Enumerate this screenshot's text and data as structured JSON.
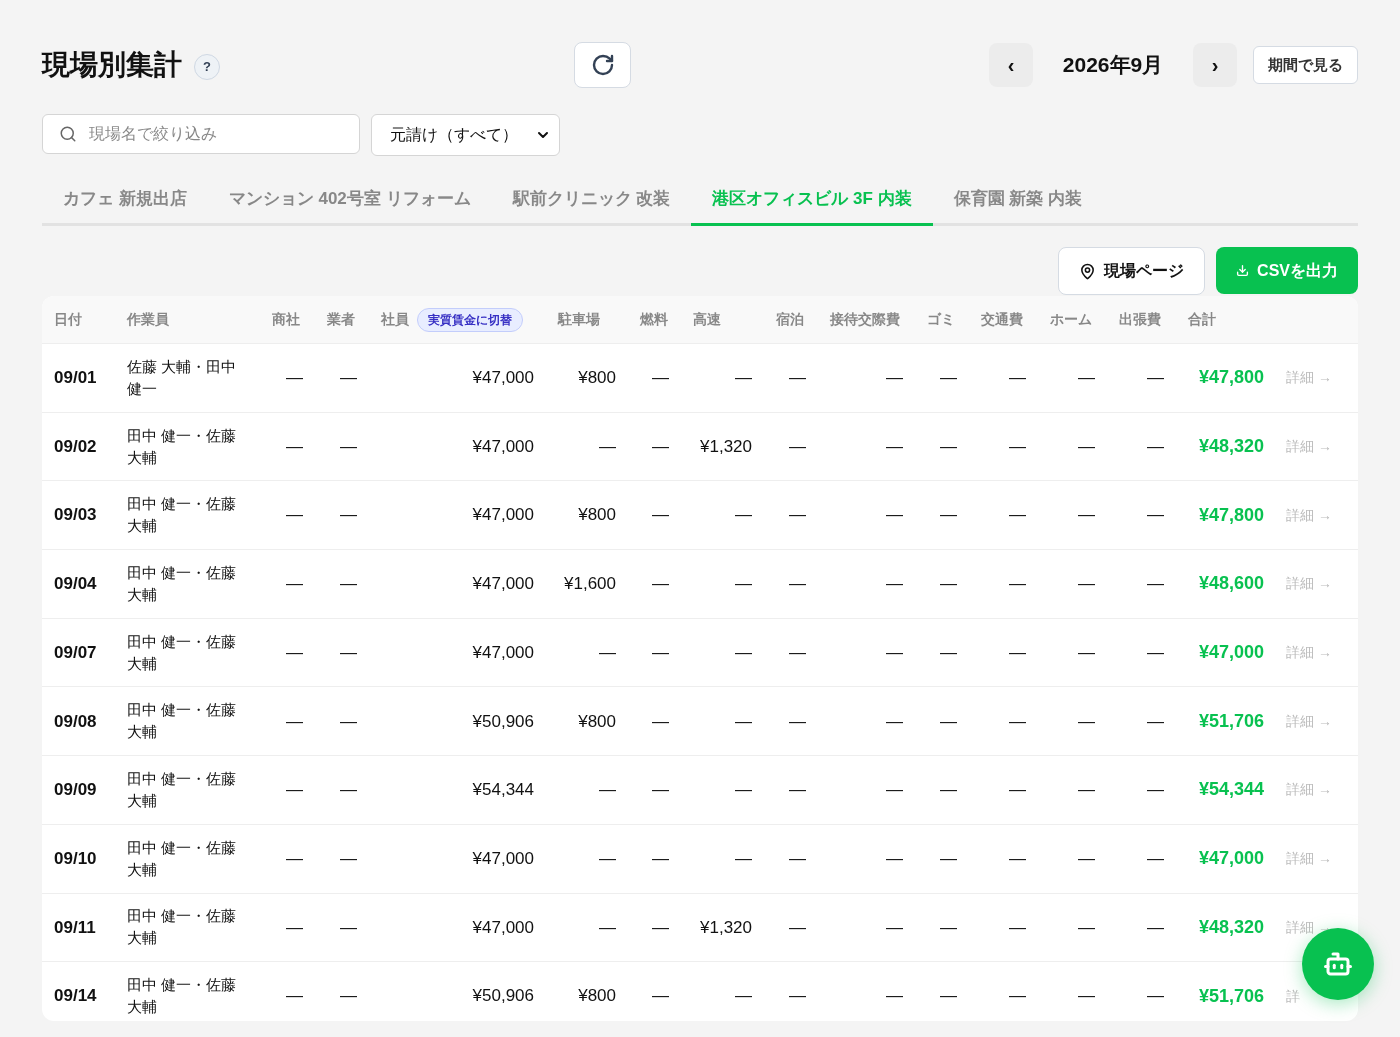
{
  "header": {
    "title": "現場別集計",
    "help": "?",
    "month": "2026年9月",
    "prev": "‹",
    "next": "›",
    "period_button": "期間で見る"
  },
  "filters": {
    "search_placeholder": "現場名で絞り込み",
    "contractor_select": "元請け（すべて）"
  },
  "tabs": [
    {
      "label": "カフェ 新規出店",
      "selected": false
    },
    {
      "label": "マンション 402号室 リフォーム",
      "selected": false
    },
    {
      "label": "駅前クリニック 改装",
      "selected": false
    },
    {
      "label": "港区オフィスビル 3F 内装",
      "selected": true
    },
    {
      "label": "保育園 新築 内装",
      "selected": false
    }
  ],
  "actions": {
    "site_page": "現場ページ",
    "csv_export": "CSVを出力"
  },
  "table": {
    "columns": [
      "日付",
      "作業員",
      "商社",
      "業者",
      "社員",
      "駐車場",
      "燃料",
      "高速",
      "宿泊",
      "接待交際費",
      "ゴミ",
      "交通費",
      "ホーム",
      "出張費",
      "合計"
    ],
    "employee_toggle": "実質賃金に切替",
    "rows": [
      {
        "date": "09/01",
        "workers": "佐藤 大輔・田中健一",
        "values": [
          "—",
          "—",
          "¥47,000",
          "¥800",
          "—",
          "—",
          "—",
          "—",
          "—",
          "—",
          "—",
          "—"
        ],
        "total": "¥47,800",
        "detail": "詳細 →"
      },
      {
        "date": "09/02",
        "workers": "田中 健一・佐藤大輔",
        "values": [
          "—",
          "—",
          "¥47,000",
          "—",
          "—",
          "¥1,320",
          "—",
          "—",
          "—",
          "—",
          "—",
          "—"
        ],
        "total": "¥48,320",
        "detail": "詳細 →"
      },
      {
        "date": "09/03",
        "workers": "田中 健一・佐藤大輔",
        "values": [
          "—",
          "—",
          "¥47,000",
          "¥800",
          "—",
          "—",
          "—",
          "—",
          "—",
          "—",
          "—",
          "—"
        ],
        "total": "¥47,800",
        "detail": "詳細 →"
      },
      {
        "date": "09/04",
        "workers": "田中 健一・佐藤大輔",
        "values": [
          "—",
          "—",
          "¥47,000",
          "¥1,600",
          "—",
          "—",
          "—",
          "—",
          "—",
          "—",
          "—",
          "—"
        ],
        "total": "¥48,600",
        "detail": "詳細 →"
      },
      {
        "date": "09/07",
        "workers": "田中 健一・佐藤大輔",
        "values": [
          "—",
          "—",
          "¥47,000",
          "—",
          "—",
          "—",
          "—",
          "—",
          "—",
          "—",
          "—",
          "—"
        ],
        "total": "¥47,000",
        "detail": "詳細 →"
      },
      {
        "date": "09/08",
        "workers": "田中 健一・佐藤大輔",
        "values": [
          "—",
          "—",
          "¥50,906",
          "¥800",
          "—",
          "—",
          "—",
          "—",
          "—",
          "—",
          "—",
          "—"
        ],
        "total": "¥51,706",
        "detail": "詳細 →"
      },
      {
        "date": "09/09",
        "workers": "田中 健一・佐藤大輔",
        "values": [
          "—",
          "—",
          "¥54,344",
          "—",
          "—",
          "—",
          "—",
          "—",
          "—",
          "—",
          "—",
          "—"
        ],
        "total": "¥54,344",
        "detail": "詳細 →"
      },
      {
        "date": "09/10",
        "workers": "田中 健一・佐藤大輔",
        "values": [
          "—",
          "—",
          "¥47,000",
          "—",
          "—",
          "—",
          "—",
          "—",
          "—",
          "—",
          "—",
          "—"
        ],
        "total": "¥47,000",
        "detail": "詳細 →"
      },
      {
        "date": "09/11",
        "workers": "田中 健一・佐藤大輔",
        "values": [
          "—",
          "—",
          "¥47,000",
          "—",
          "—",
          "¥1,320",
          "—",
          "—",
          "—",
          "—",
          "—",
          "—"
        ],
        "total": "¥48,320",
        "detail": "詳細 →"
      },
      {
        "date": "09/14",
        "workers": "田中 健一・佐藤大輔",
        "values": [
          "—",
          "—",
          "¥50,906",
          "¥800",
          "—",
          "—",
          "—",
          "—",
          "—",
          "—",
          "—",
          "—"
        ],
        "total": "¥51,706",
        "detail": "詳"
      }
    ]
  }
}
